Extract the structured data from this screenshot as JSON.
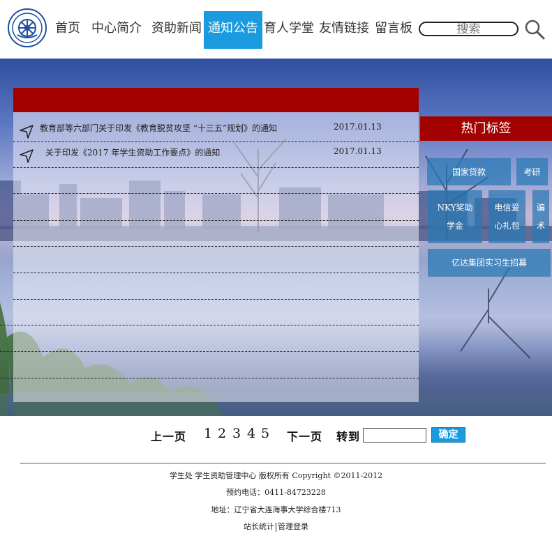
{
  "header": {
    "nav_items": [
      {
        "label": "首页"
      },
      {
        "label": "中心简介"
      },
      {
        "label": "资助新闻"
      },
      {
        "label": "通知公告",
        "active": true
      },
      {
        "label": "育人学堂"
      },
      {
        "label": "友情链接"
      },
      {
        "label": "留言板"
      }
    ],
    "search_placeholder": "搜索",
    "active_color": "#1a9be0"
  },
  "notices": {
    "header_color": "#a30000",
    "items": [
      {
        "title": "教育部等六部门关于印发《教育脱贫攻坚 “十三五”规划》的通知",
        "date": "2017.01.13"
      },
      {
        "title": "关于印发《2017 年学生资助工作要点》的通知",
        "date": "2017.01.13"
      }
    ]
  },
  "tags": {
    "title": "热门标签",
    "items": [
      {
        "label": "国家贷款"
      },
      {
        "label": "考研"
      },
      {
        "label": "NKY奖助\n学金"
      },
      {
        "label": "电信爱\n心礼包"
      },
      {
        "label": "骗\n术"
      },
      {
        "label": "亿达集团实习生招募"
      }
    ]
  },
  "pagination": {
    "prev_label": "上一页",
    "pages": [
      "1",
      "2",
      "3",
      "4",
      "5"
    ],
    "next_label": "下一页",
    "goto_label": "转到",
    "goto_value": "",
    "confirm_label": "确定"
  },
  "footer": {
    "line1": "学生处 学生资助管理中心 版权所有 Copyright ©2011-2012",
    "line2": "预约电话：0411-84723228",
    "line3": "地址：辽宁省大连海事大学综合楼713",
    "link_stats": "站长统计",
    "link_admin": "管理登录"
  }
}
